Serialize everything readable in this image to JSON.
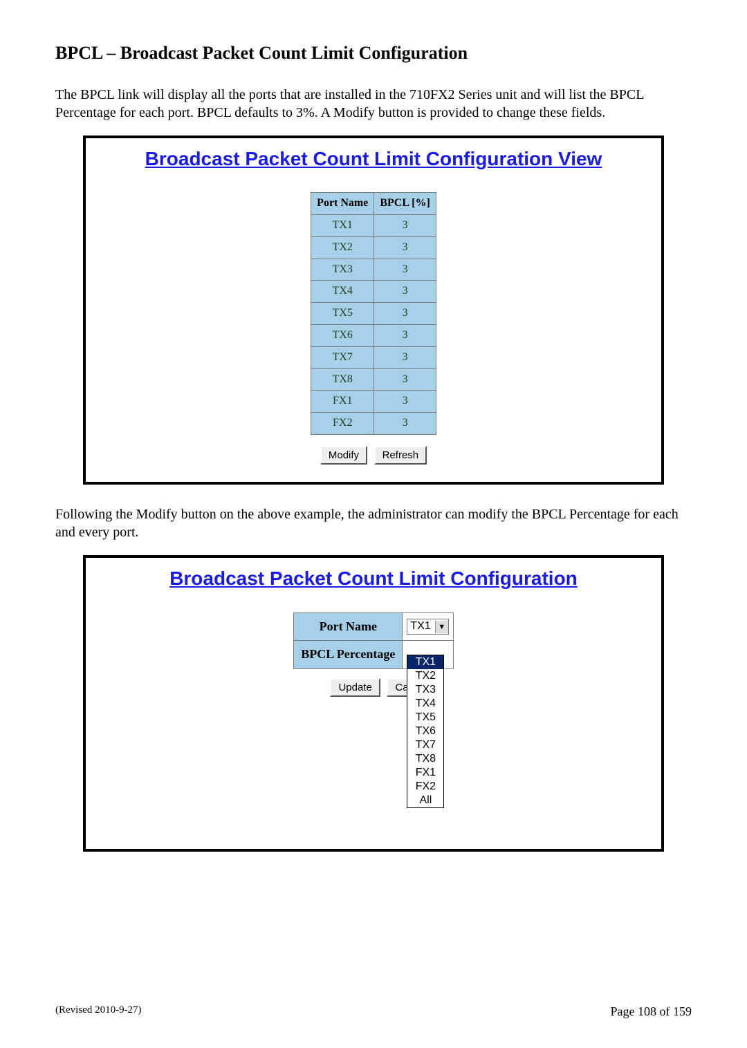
{
  "heading": "BPCL – Broadcast Packet Count Limit Configuration",
  "para1": "The BPCL link will display all the ports that are installed in the 710FX2 Series unit and will list the BPCL Percentage for each port.  BPCL defaults to 3%. A Modify button is provided to change these fields.",
  "panel1": {
    "title": "Broadcast Packet Count Limit Configuration View",
    "col1": "Port Name",
    "col2": "BPCL [%]",
    "rows": [
      {
        "name": "TX1",
        "pct": "3"
      },
      {
        "name": "TX2",
        "pct": "3"
      },
      {
        "name": "TX3",
        "pct": "3"
      },
      {
        "name": "TX4",
        "pct": "3"
      },
      {
        "name": "TX5",
        "pct": "3"
      },
      {
        "name": "TX6",
        "pct": "3"
      },
      {
        "name": "TX7",
        "pct": "3"
      },
      {
        "name": "TX8",
        "pct": "3"
      },
      {
        "name": "FX1",
        "pct": "3"
      },
      {
        "name": "FX2",
        "pct": "3"
      }
    ],
    "modify": "Modify",
    "refresh": "Refresh"
  },
  "para2": "Following the Modify button on the above example, the administrator can modify the BPCL Percentage for each and every port.",
  "panel2": {
    "title": "Broadcast Packet Count Limit Configuration",
    "field_port": "Port Name",
    "field_bpcl": "BPCL Percentage",
    "selected": "TX1",
    "update": "Update",
    "cancel_partial": "Ca",
    "options": [
      "TX1",
      "TX2",
      "TX3",
      "TX4",
      "TX5",
      "TX6",
      "TX7",
      "TX8",
      "FX1",
      "FX2",
      "All"
    ]
  },
  "footer_left": "(Revised 2010-9-27)",
  "footer_right": "Page 108 of 159"
}
